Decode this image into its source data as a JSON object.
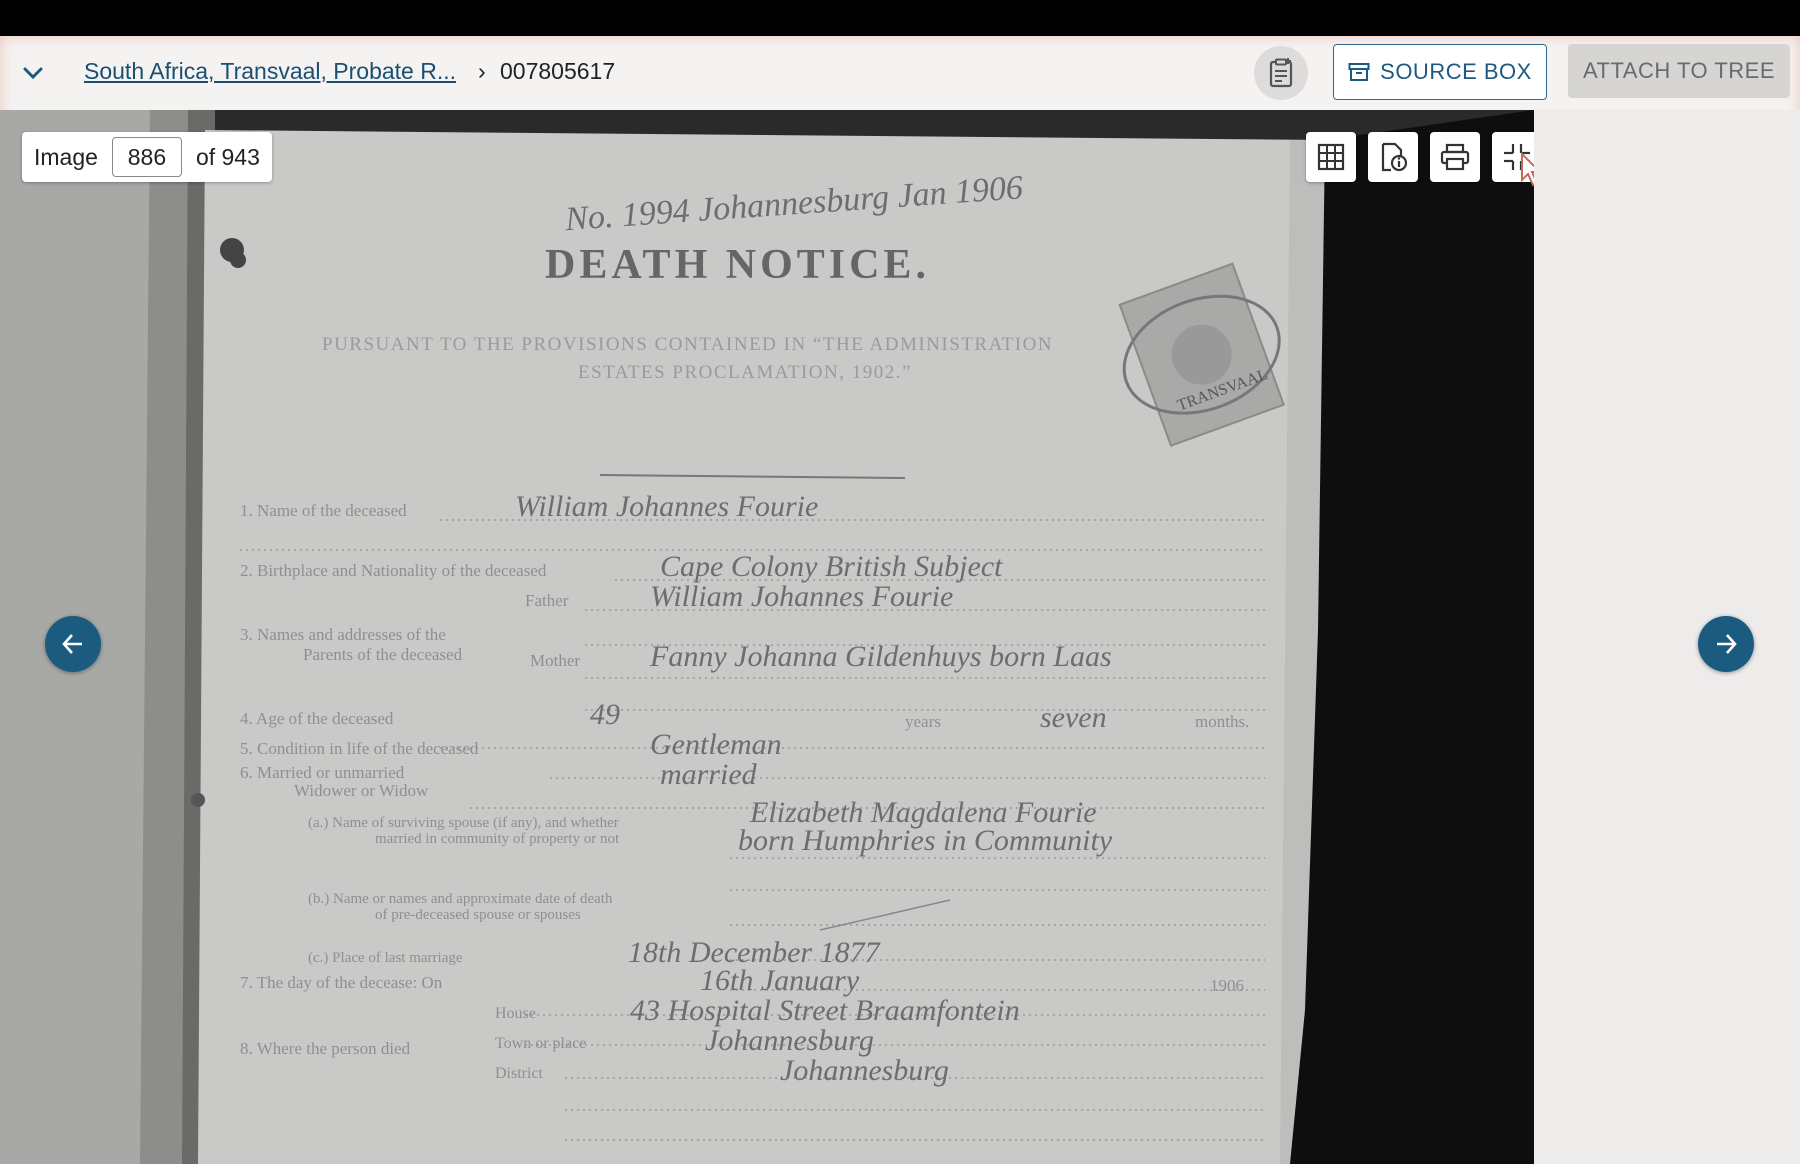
{
  "header": {
    "breadcrumb_link": "South Africa, Transvaal, Probate R...",
    "breadcrumb_separator": "›",
    "breadcrumb_current": "007805617",
    "source_box_label": "SOURCE BOX",
    "attach_label": "ATTACH TO TREE"
  },
  "viewer": {
    "image_label": "Image",
    "image_number": "886",
    "image_total": "of 943"
  },
  "document": {
    "title": "DEATH NOTICE.",
    "subtitle_1": "PURSUANT TO THE PROVISIONS CONTAINED IN “THE ADMINISTRATION",
    "subtitle_2": "ESTATES PROCLAMATION, 1902.”",
    "fields": [
      {
        "label": "1. Name of the deceased",
        "value": "William Johannes Fourie"
      },
      {
        "label": "2. Birthplace and Nationality of the deceased",
        "value": "Cape Colony British Subject"
      },
      {
        "label": "Father",
        "value": "William Johannes Fourie"
      },
      {
        "label": "3. Names and addresses of the",
        "value": ""
      },
      {
        "label": "Parents of the deceased",
        "value": ""
      },
      {
        "label": "Mother",
        "value": "Fanny Johanna Gildenhuys born Laas"
      },
      {
        "label": "4. Age of the deceased",
        "value": "49"
      },
      {
        "label": "years",
        "value": "seven"
      },
      {
        "label": "months.",
        "value": ""
      },
      {
        "label": "5. Condition in life of the deceased",
        "value": "Gentleman"
      },
      {
        "label": "6. Married or unmarried",
        "value": "married"
      },
      {
        "label": "Widower or Widow",
        "value": ""
      },
      {
        "label": "(a.) Name of surviving spouse (if any), and whether",
        "value": "Elizabeth Magdalena Fourie"
      },
      {
        "label": "married in community of property or not",
        "value": "born Humphries in Community"
      },
      {
        "label": "(b.) Name or names and approximate date of death",
        "value": ""
      },
      {
        "label": "of pre-deceased spouse or spouses",
        "value": ""
      },
      {
        "label": "(c.) Place of last marriage",
        "value": "18th December 1877"
      },
      {
        "label": "7. The day of the decease: On",
        "value": "16th January"
      },
      {
        "label": "1906",
        "value": ""
      },
      {
        "label": "House",
        "value": "43 Hospital Street Braamfontein"
      },
      {
        "label": "8. Where the person died",
        "value": ""
      },
      {
        "label": "Town or place",
        "value": "Johannesburg"
      },
      {
        "label": "District",
        "value": "Johannesburg"
      }
    ],
    "header_scrawl": "No. 1994 Johannesburg Jan 1906",
    "stamp_text": "TRANSVAAL"
  },
  "colors": {
    "accent": "#1c5b80",
    "link": "#1a4f72",
    "paper": "#c9c9c7",
    "ink_print": "#8a8a8a",
    "ink_hand": "#6d6d6d"
  }
}
